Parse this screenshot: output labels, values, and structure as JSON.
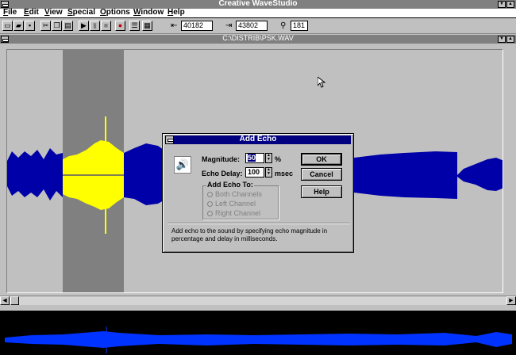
{
  "app": {
    "title": "Creative WaveStudio"
  },
  "menu": [
    "File",
    "Edit",
    "View",
    "Special",
    "Options",
    "Window",
    "Help"
  ],
  "toolbar": {
    "start_value": "40182",
    "end_value": "43802",
    "zoom_value": "181",
    "buttons": [
      "new-icon",
      "open-icon",
      "save-icon",
      "cut-icon",
      "copy-icon",
      "paste-icon",
      "play-icon",
      "pause-icon",
      "stop-icon",
      "record-icon",
      "list-icon",
      "options-icon"
    ]
  },
  "document": {
    "title": "C:\\DISTRIB\\PSK.WAV"
  },
  "colors": {
    "waveform": "#0000a8",
    "selected_waveform": "#ffff00",
    "selection_background": "#808080",
    "overview_waveform": "#0033ff",
    "dialog_title": "#000080"
  },
  "dialog": {
    "title": "Add Echo",
    "magnitude_label": "Magnitude:",
    "magnitude_value": "50",
    "magnitude_unit": "%",
    "delay_label": "Echo Delay:",
    "delay_value": "100",
    "delay_unit": "msec",
    "ok_label": "OK",
    "cancel_label": "Cancel",
    "help_label": "Help",
    "add_to_label": "Add Echo To:",
    "options": [
      "Both Channels",
      "Left Channel",
      "Right Channel"
    ],
    "help_text": "Add echo to the sound by specifying echo magnitude in percentage and delay in milliseconds."
  }
}
